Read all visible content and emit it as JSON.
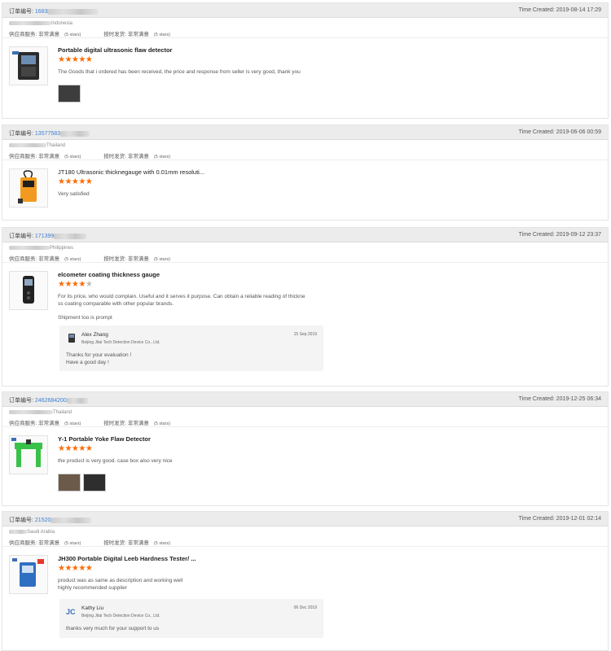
{
  "labels": {
    "order_prefix": "订单编号:",
    "time_prefix": "Time Created:",
    "svc_label": "供应商服务:",
    "svc_value": "非常满意",
    "ship_label": "按时发货:",
    "ship_value": "非常满意",
    "stars_note": "(5 stars)"
  },
  "colors": {
    "accent_star": "#ff6a00",
    "link": "#3a7fd0"
  },
  "orders": [
    {
      "order_no": "1683",
      "time": "2019-08-14 17:29",
      "country": "Indonesia",
      "title": "Portable digital ultrasonic flaw detector",
      "rating": 5,
      "review": [
        "The Goods that i ordered has been received, the price and response from seller is very good, thank you"
      ],
      "thumb_icon": "flaw-detector-icon"
    },
    {
      "order_no": "13577583",
      "time": "2019-06-06 00:59",
      "country": "Thailand",
      "title": "JT180 Ultrasonic thicknegauge with 0.01mm resoluti...",
      "rating": 5,
      "review": [
        "Very satisfied"
      ],
      "thumb_icon": "thickness-gauge-icon"
    },
    {
      "order_no": "171399",
      "time": "2019-09-12 23:37",
      "country": "Philippines",
      "title": "elcometer coating thickness gauge",
      "rating": 4,
      "review": [
        "For its price, who would complain.  Useful and it serves it purpose.  Can obtain a reliable reading of thickne",
        "ss coating comparable with other popular brands.",
        "",
        "Shipment too is prompt"
      ],
      "thumb_icon": "coating-gauge-icon",
      "reply": {
        "name": "Alex Zhang",
        "company": "Beijing Jitai Tech Detection Device Co., Ltd.",
        "date": "15 Sep 2019",
        "message": [
          "Thanks for your evaluation !",
          "Have a good day !"
        ]
      }
    },
    {
      "order_no": "2462684200",
      "time": "2019-12-25 06:34",
      "country": "Thailand",
      "title": "Y-1 Portable Yoke Flaw Detector",
      "rating": 5,
      "review": [
        "the product is very good. case box also very nice"
      ],
      "thumb_icon": "yoke-detector-icon"
    },
    {
      "order_no": "21520",
      "time": "2019-12-01 02:14",
      "country": "Saudi Arabia",
      "title": "JH300 Portable Digital Leeb Hardness Tester/ ...",
      "rating": 5,
      "review": [
        "product was as same as description and working well",
        "highly recommended supplier"
      ],
      "thumb_icon": "hardness-tester-icon",
      "reply": {
        "name": "Kathy Liu",
        "company": "Beijing Jitai Tech Detection Device Co., Ltd.",
        "date": "06 Dec 2019",
        "message": [
          "thanks very much for your support to us"
        ]
      }
    }
  ]
}
